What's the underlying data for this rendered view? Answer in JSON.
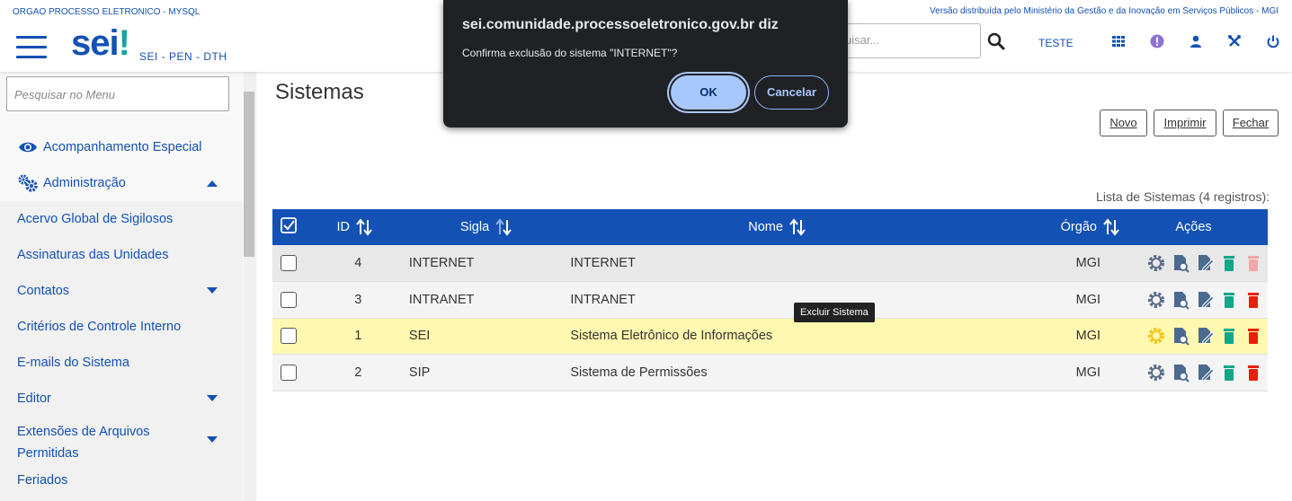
{
  "header": {
    "org": "ORGAO PROCESSO ELETRONICO - MYSQL",
    "distribution": "Versão distribuída pelo Ministério da Gestão e da Inovação em Serviços Públicos - MGI",
    "logo_text": "sei",
    "logo_dot": "!",
    "system_name": "SEI - PEN - DTH",
    "search_placeholder": "uisar...",
    "unit": "TESTE"
  },
  "sidebar": {
    "search_placeholder": "Pesquisar no Menu",
    "items": [
      {
        "label": "Acompanhamento Especial"
      },
      {
        "label": "Administração"
      },
      {
        "label": "Acervo Global de Sigilosos"
      },
      {
        "label": "Assinaturas das Unidades"
      },
      {
        "label": "Contatos"
      },
      {
        "label": "Critérios de Controle Interno"
      },
      {
        "label": "E-mails do Sistema"
      },
      {
        "label": "Editor"
      },
      {
        "label": "Extensões de Arquivos"
      },
      {
        "label": "Permitidas"
      },
      {
        "label": "Feriados"
      }
    ]
  },
  "main": {
    "title": "Sistemas",
    "buttons": {
      "novo": "Novo",
      "imprimir": "Imprimir",
      "fechar": "Fechar"
    },
    "caption": "Lista de Sistemas (4 registros):",
    "columns": {
      "id": "ID",
      "sigla": "Sigla",
      "nome": "Nome",
      "orgao": "Órgão",
      "acoes": "Ações"
    },
    "rows": [
      {
        "id": "4",
        "sigla": "INTERNET",
        "nome": "INTERNET",
        "orgao": "MGI"
      },
      {
        "id": "3",
        "sigla": "INTRANET",
        "nome": "INTRANET",
        "orgao": "MGI"
      },
      {
        "id": "1",
        "sigla": "SEI",
        "nome": "Sistema Eletrônico de Informações",
        "orgao": "MGI"
      },
      {
        "id": "2",
        "sigla": "SIP",
        "nome": "Sistema de Permissões",
        "orgao": "MGI"
      }
    ],
    "tooltip": "Excluir Sistema"
  },
  "dialog": {
    "title": "sei.comunidade.processoeletronico.gov.br diz",
    "message": "Confirma exclusão do sistema \"INTERNET\"?",
    "ok": "OK",
    "cancel": "Cancelar"
  },
  "colors": {
    "primary": "#1351b4",
    "teal": "#14a5a2",
    "delete": "#e52207",
    "highlight": "#fff8b0"
  }
}
